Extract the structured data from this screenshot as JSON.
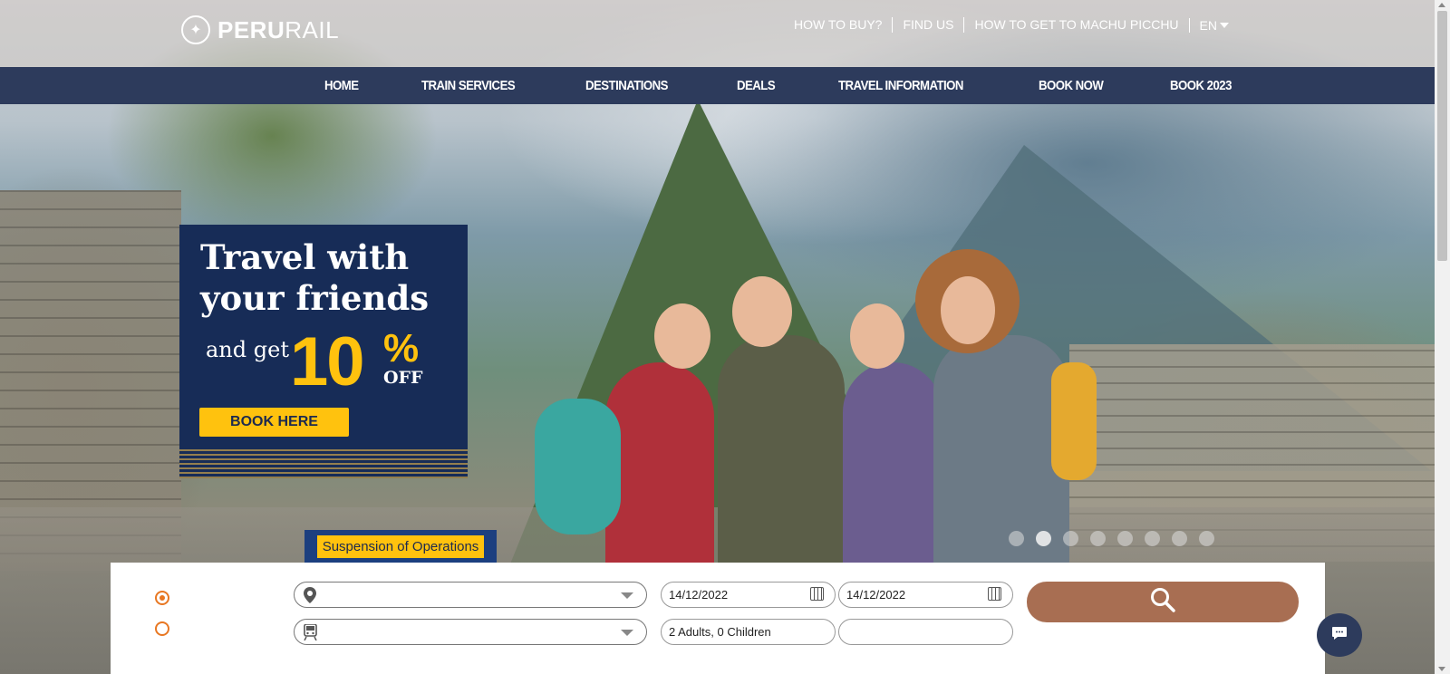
{
  "brand": {
    "logo_strong": "PERU",
    "logo_light": "RAIL"
  },
  "top_links": [
    "HOW TO BUY?",
    "FIND US",
    "HOW TO GET TO MACHU PICCHU"
  ],
  "language": "EN",
  "nav": [
    "HOME",
    "TRAIN SERVICES",
    "DESTINATIONS",
    "DEALS",
    "TRAVEL INFORMATION",
    "BOOK NOW",
    "BOOK 2023"
  ],
  "promo": {
    "title": "Travel with your friends",
    "prefix": "and get",
    "number": "10",
    "percent": "%",
    "off": "OFF",
    "button": "BOOK HERE"
  },
  "notice": "Suspension of Operations",
  "carousel": {
    "slides": 8,
    "active_index": 1
  },
  "booking": {
    "date_out": "14/12/2022",
    "date_return": "14/12/2022",
    "passengers": "2 Adults, 0 Children",
    "promo_code": "",
    "trip_type_selected": 0
  },
  "icons": {
    "location": "map-pin-icon",
    "train": "train-icon",
    "calendar": "calendar-icon",
    "search": "search-icon",
    "chat": "chat-icon"
  },
  "colors": {
    "nav_bg": "#2d3b5c",
    "promo_bg": "#172c57",
    "accent_yellow": "#ffc20e",
    "search_button": "#a86e52",
    "radio": "#e87722"
  }
}
